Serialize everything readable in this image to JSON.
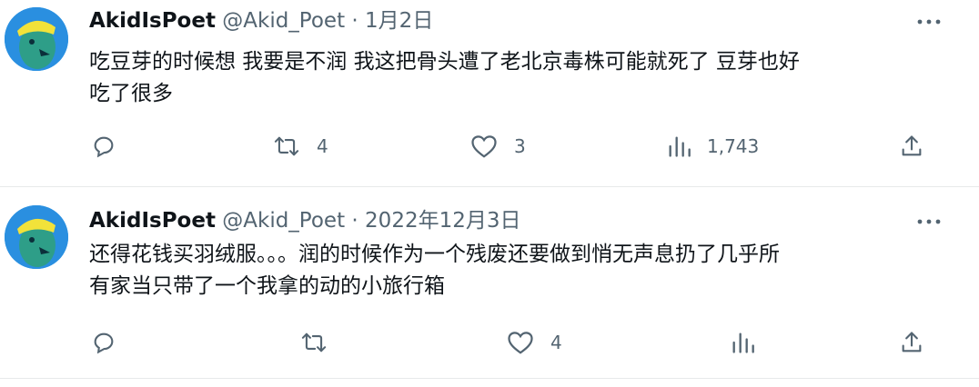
{
  "tweets": [
    {
      "display_name": "AkidIsPoet",
      "handle": "@Akid_Poet",
      "separator": "·",
      "date": "1月2日",
      "text_lines": [
        "吃豆芽的时候想 我要是不润 我这把骨头遭了老北京毒株可能就死了 豆芽也好",
        "吃了很多"
      ],
      "actions": {
        "reply_count": "",
        "retweet_count": "4",
        "like_count": "3",
        "views_count": "1,743"
      }
    },
    {
      "display_name": "AkidIsPoet",
      "handle": "@Akid_Poet",
      "separator": "·",
      "date": "2022年12月3日",
      "text_lines": [
        "还得花钱买羽绒服。。。润的时候作为一个残废还要做到悄无声息扔了几乎所",
        "有家当只带了一个我拿的动的小旅行箱"
      ],
      "actions": {
        "reply_count": "",
        "retweet_count": "",
        "like_count": "4",
        "views_count": ""
      }
    }
  ],
  "icons": [
    "avatar",
    "more-icon",
    "reply-icon",
    "retweet-icon",
    "like-icon",
    "views-icon",
    "share-icon"
  ],
  "colors": {
    "text": "#0f1419",
    "secondary": "#536471",
    "divider": "#e7e9ea"
  }
}
